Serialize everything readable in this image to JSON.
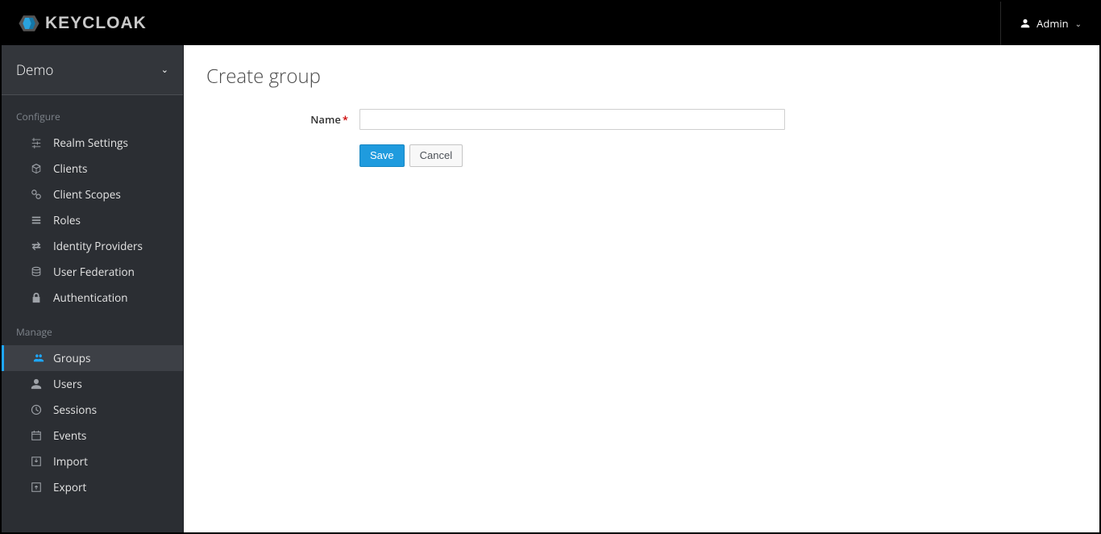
{
  "header": {
    "brand": "KEYCLOAK",
    "user_label": "Admin"
  },
  "sidebar": {
    "realm": "Demo",
    "section_configure": "Configure",
    "section_manage": "Manage",
    "configure_items": [
      {
        "label": "Realm Settings",
        "icon": "sliders-icon"
      },
      {
        "label": "Clients",
        "icon": "cube-icon"
      },
      {
        "label": "Client Scopes",
        "icon": "scopes-icon"
      },
      {
        "label": "Roles",
        "icon": "list-icon"
      },
      {
        "label": "Identity Providers",
        "icon": "exchange-icon"
      },
      {
        "label": "User Federation",
        "icon": "database-icon"
      },
      {
        "label": "Authentication",
        "icon": "lock-icon"
      }
    ],
    "manage_items": [
      {
        "label": "Groups",
        "icon": "group-icon",
        "active": true
      },
      {
        "label": "Users",
        "icon": "user-icon"
      },
      {
        "label": "Sessions",
        "icon": "clock-icon"
      },
      {
        "label": "Events",
        "icon": "calendar-icon"
      },
      {
        "label": "Import",
        "icon": "import-icon"
      },
      {
        "label": "Export",
        "icon": "export-icon"
      }
    ]
  },
  "main": {
    "title": "Create group",
    "form": {
      "name_label": "Name",
      "name_value": "",
      "save_label": "Save",
      "cancel_label": "Cancel"
    }
  }
}
